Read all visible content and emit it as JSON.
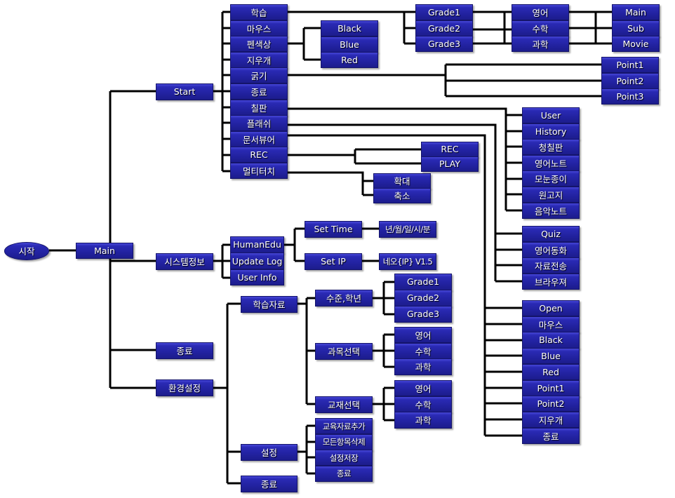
{
  "root": "시작",
  "main": "Main",
  "main_menu": [
    "Start",
    "시스템정보",
    "종료",
    "환경설정"
  ],
  "start_menu": [
    "학습",
    "마우스",
    "펜색상",
    "지우개",
    "굵기",
    "종료",
    "칠판",
    "플래쉬",
    "문서뷰어",
    "REC",
    "멀티터치"
  ],
  "pen_colors": [
    "Black",
    "Blue",
    "Red"
  ],
  "study": {
    "grades": [
      "Grade1",
      "Grade2",
      "Grade3"
    ],
    "subjects": [
      "영어",
      "수학",
      "과학"
    ],
    "media": [
      "Main",
      "Sub",
      "Movie"
    ]
  },
  "thickness": [
    "Point1",
    "Point2",
    "Point3"
  ],
  "blackboard": [
    "User",
    "History",
    "청칠판",
    "영어노트",
    "모눈종이",
    "원고지",
    "음악노트"
  ],
  "flash": [
    "Quiz",
    "영어동화",
    "자료전송",
    "브라우져"
  ],
  "doc_viewer": [
    "Open",
    "마우스",
    "Black",
    "Blue",
    "Red",
    "Point1",
    "Point2",
    "지우개",
    "종료"
  ],
  "rec": [
    "REC",
    "PLAY"
  ],
  "multitouch": [
    "확대",
    "축소"
  ],
  "system_info": {
    "items": [
      "HumanEdu",
      "Update Log",
      "User Info"
    ],
    "set_time": "Set Time",
    "set_ip": "Set IP",
    "time_format": "년/월/일/시/분",
    "ip_version": "네오{IP} V1.5"
  },
  "settings": {
    "items": [
      "학습자료",
      "설정",
      "종료"
    ],
    "learning": [
      "수준,학년",
      "과목선택",
      "교재선택"
    ],
    "level": [
      "Grade1",
      "Grade2",
      "Grade3"
    ],
    "subject": [
      "영어",
      "수학",
      "과학"
    ],
    "textbook": [
      "영어",
      "수학",
      "과학"
    ],
    "config": [
      "교육자료추가",
      "모든항목삭제",
      "설정저장",
      "종료"
    ]
  },
  "colors": {
    "box": "#2626a8",
    "line": "#000000",
    "text": "#ffffff"
  }
}
